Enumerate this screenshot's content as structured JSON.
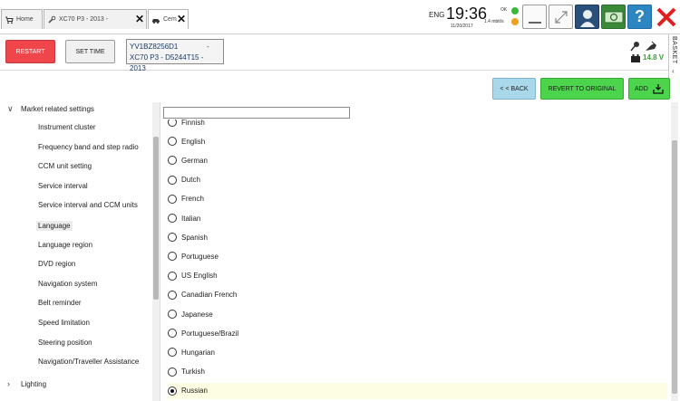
{
  "tabs": [
    {
      "label": "Home",
      "icon": "home-cart-icon"
    },
    {
      "label": "XC70 P3 - 2013 -",
      "icon": "wrench-icon"
    },
    {
      "label": "Cem",
      "icon": "car-icon"
    }
  ],
  "status": {
    "language": "ENG",
    "time": "19:36",
    "date": "11/20/2017",
    "connection": "OK",
    "speed": "1.4 mbit/s",
    "voltage": "14.8 V"
  },
  "toolbar": {
    "restart_label": "RESTART",
    "settime_label": "SET TIME"
  },
  "vehicle": {
    "vin": "YV1BZ8256D1",
    "dash": "-",
    "model": "XC70 P3 - D5244T15 - 2013"
  },
  "basket": {
    "label": "BASKET"
  },
  "actions": {
    "back_label": "< < BACK",
    "revert_label": "REVERT TO ORIGINAL",
    "add_label": "ADD"
  },
  "tree": {
    "group_label": "Market related settings",
    "items": [
      "Instrument cluster",
      "Frequency band and step radio",
      "CCM unit setting",
      "Service interval",
      "Service interval and CCM units",
      "Language",
      "Language region",
      "DVD region",
      "Navigation system",
      "Belt reminder",
      "Speed limitation",
      "Steering position",
      "Navigation/Traveller Assistance"
    ],
    "selected_item": "Language",
    "next_group_label": "Lighting"
  },
  "languages": [
    "Finnish",
    "English",
    "German",
    "Dutch",
    "French",
    "Italian",
    "Spanish",
    "Portuguese",
    "US English",
    "Canadian French",
    "Japanese",
    "Portuguese/Brazil",
    "Hungarian",
    "Turkish",
    "Russian"
  ],
  "selected_language": "Russian",
  "colors": {
    "restart": "#f0464b",
    "back": "#a9d8ea",
    "revert": "#4dd44d",
    "add": "#4dd44d",
    "help": "#2e86c1",
    "voltage": "#3da03d",
    "selected_row": "#fdfde4"
  }
}
